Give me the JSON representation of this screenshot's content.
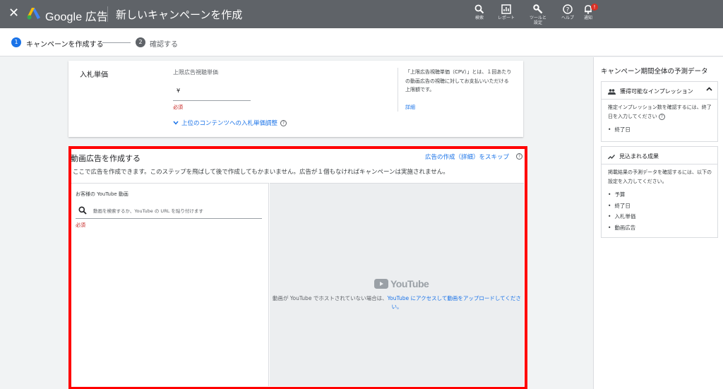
{
  "topbar": {
    "close_glyph": "✕",
    "brand": "Google 広告",
    "page_title": "新しいキャンペーンを作成",
    "tools": [
      {
        "icon": "search-icon",
        "label": "検索"
      },
      {
        "icon": "reports-icon",
        "label": "レポート"
      },
      {
        "icon": "wrench-icon",
        "label": "ツールと設定"
      },
      {
        "icon": "help-icon",
        "label": "ヘルプ"
      },
      {
        "icon": "bell-icon",
        "label": "通知",
        "badge": "!"
      }
    ]
  },
  "stepper": {
    "steps": [
      {
        "number": "1",
        "label": "キャンペーンを作成する",
        "active": true
      },
      {
        "number": "2",
        "label": "確認する",
        "active": false
      }
    ]
  },
  "bid": {
    "title": "入札単価",
    "field_label": "上限広告視聴単価",
    "currency": "¥",
    "required": "必須",
    "adjust_link": "上位のコンテンツへの入札単価調整",
    "help_text": "「上限広告視聴単価（CPV）」とは、１回あたりの動画広告の視聴に対してお支払いいただける上限額です。",
    "help_link": "詳細"
  },
  "video": {
    "title": "動画広告を作成する",
    "skip_link": "広告の作成（詳細）をスキップ",
    "description": "ここで広告を作成できます。このステップを飛ばして後で作成してもかまいません。広告が１個もなければキャンペーンは実施されません。",
    "youtube_label": "お客様の YouTube 動画",
    "search_placeholder": "動画を検索するか、YouTube の URL を貼り付けます",
    "required": "必須",
    "yt_logo_text": "YouTube",
    "message_prefix": "動画が YouTube でホストされていない場合は、",
    "message_link": "YouTube にアクセスして動画をアップロードしてください。"
  },
  "sidebar": {
    "title": "キャンペーン期間全体の予測データ",
    "impressions": {
      "title": "獲得可能なインプレッション",
      "body": "推定インプレッション数を確認するには、終了日を入力してください",
      "items": [
        "終了日"
      ]
    },
    "results": {
      "title": "見込まれる成果",
      "body": "掲載結果の予測データを確認するには、以下の設定を入力してください。",
      "items": [
        "予算",
        "終了日",
        "入札単価",
        "動画広告"
      ]
    }
  },
  "colors": {
    "topbar": "#5f6368",
    "accent": "#1a73e8",
    "required": "#c5221f",
    "highlight_frame": "#ff0000",
    "step_active": "#1a73e8",
    "step_inactive": "#5f6368"
  }
}
